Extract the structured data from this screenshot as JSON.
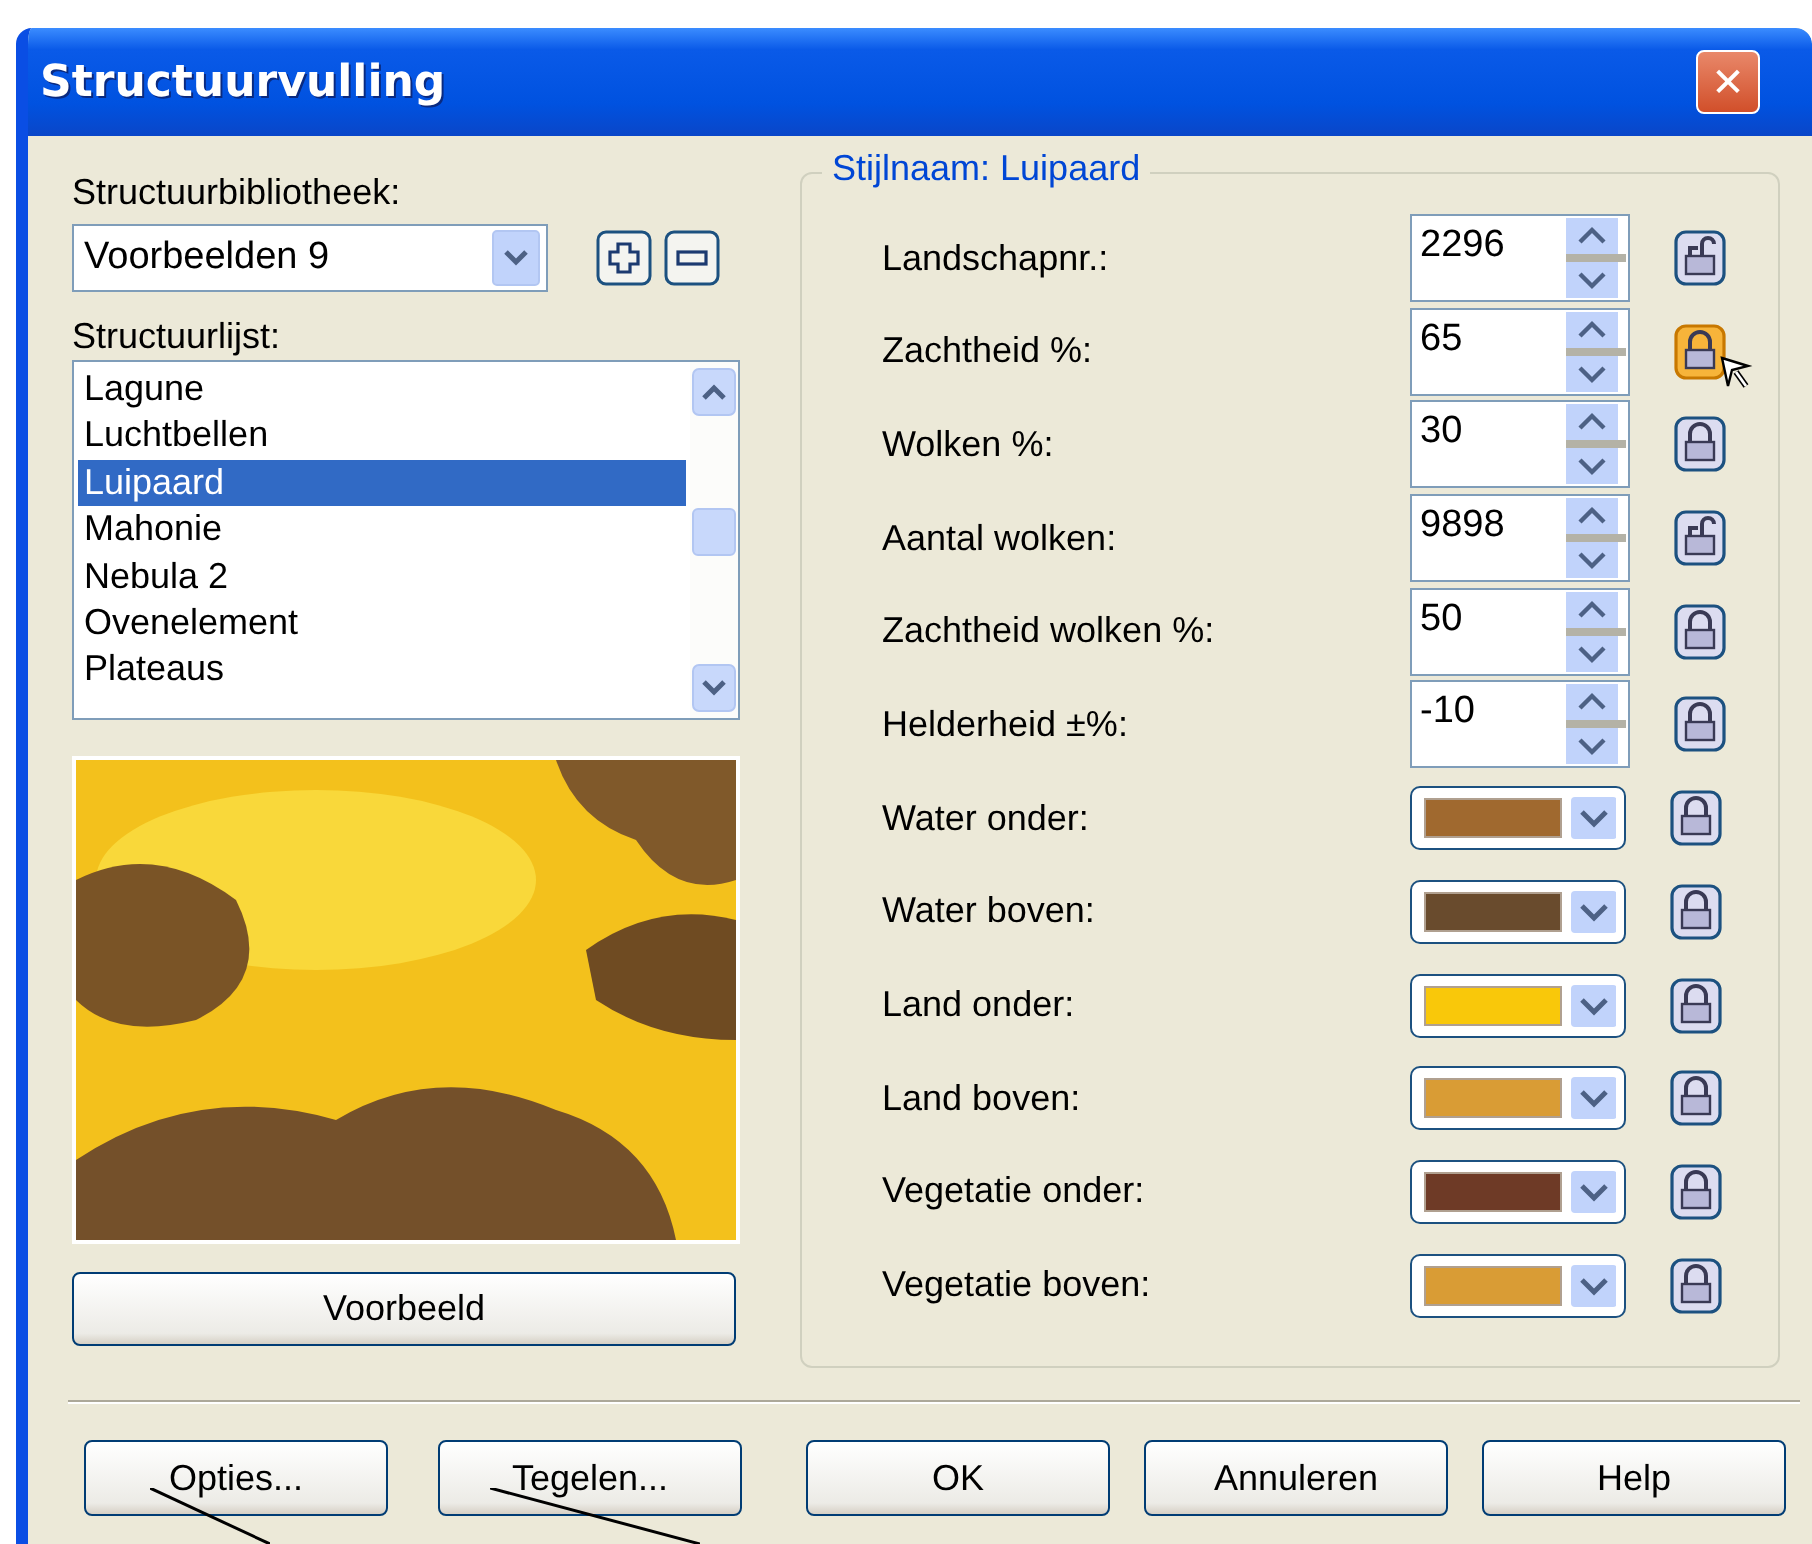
{
  "window": {
    "title": "Structuurvulling",
    "close": "✕"
  },
  "library": {
    "label": "Structuurbibliotheek:",
    "value": "Voorbeelden 9"
  },
  "list": {
    "label": "Structuurlijst:",
    "items": [
      {
        "label": "Lagune",
        "selected": false
      },
      {
        "label": "Luchtbellen",
        "selected": false
      },
      {
        "label": "Luipaard",
        "selected": true
      },
      {
        "label": "Mahonie",
        "selected": false
      },
      {
        "label": "Nebula 2",
        "selected": false
      },
      {
        "label": "Ovenelement",
        "selected": false
      },
      {
        "label": "Plateaus",
        "selected": false
      }
    ]
  },
  "preview_button": "Voorbeeld",
  "style_group": {
    "title": "Stijlnaam: Luipaard",
    "rows": [
      {
        "kind": "spin",
        "label": "Landschapnr.:",
        "value": "2296",
        "locked": false,
        "hovered": false
      },
      {
        "kind": "spin",
        "label": "Zachtheid %:",
        "value": "65",
        "locked": true,
        "hovered": true
      },
      {
        "kind": "spin",
        "label": "Wolken %:",
        "value": "30",
        "locked": true,
        "hovered": false
      },
      {
        "kind": "spin",
        "label": "Aantal wolken:",
        "value": "9898",
        "locked": false,
        "hovered": false
      },
      {
        "kind": "spin",
        "label": "Zachtheid wolken %:",
        "value": "50",
        "locked": true,
        "hovered": false
      },
      {
        "kind": "spin",
        "label": "Helderheid ±%:",
        "value": "-10",
        "locked": true,
        "hovered": false
      },
      {
        "kind": "color",
        "label": "Water onder:",
        "color": "#a0692f",
        "locked": true,
        "hovered": false
      },
      {
        "kind": "color",
        "label": "Water boven:",
        "color": "#694b2d",
        "locked": true,
        "hovered": false
      },
      {
        "kind": "color",
        "label": "Land onder:",
        "color": "#f9c80a",
        "locked": true,
        "hovered": false
      },
      {
        "kind": "color",
        "label": "Land boven:",
        "color": "#d99c35",
        "locked": true,
        "hovered": false
      },
      {
        "kind": "color",
        "label": "Vegetatie onder:",
        "color": "#6e3a26",
        "locked": true,
        "hovered": false
      },
      {
        "kind": "color",
        "label": "Vegetatie boven:",
        "color": "#d99c35",
        "locked": true,
        "hovered": false
      }
    ]
  },
  "buttons": [
    "Opties...",
    "Tegelen...",
    "OK",
    "Annuleren",
    "Help"
  ]
}
